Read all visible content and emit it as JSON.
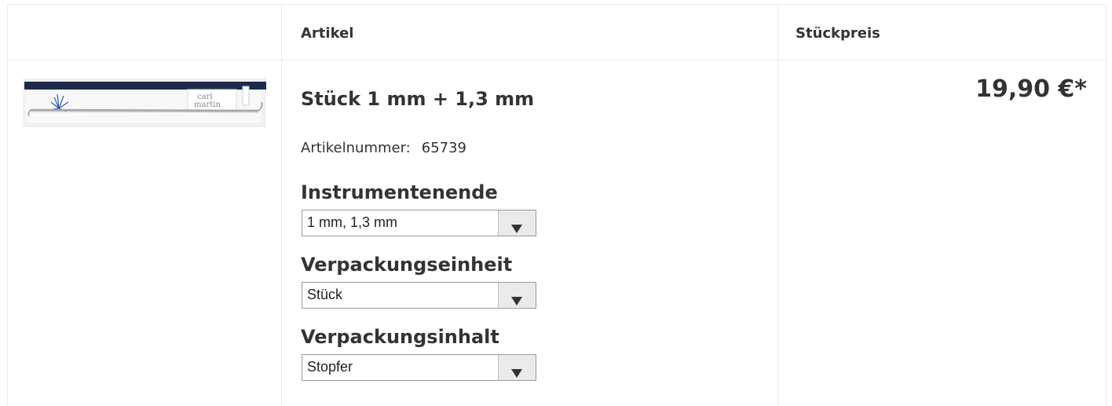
{
  "table": {
    "headers": {
      "image": "",
      "article": "Artikel",
      "unit_price": "Stückpreis"
    }
  },
  "product": {
    "image_alt": "Stopfer product image",
    "image_brand_text": "carl martin",
    "title": "Stück 1 mm + 1,3 mm",
    "article_number_label": "Artikelnummer:",
    "article_number": "65739",
    "price": "19,90 €*",
    "options": [
      {
        "label": "Instrumentenende",
        "selected": "1 mm, 1,3 mm"
      },
      {
        "label": "Verpackungseinheit",
        "selected": "Stück"
      },
      {
        "label": "Verpackungsinhalt",
        "selected": "Stopfer"
      }
    ]
  },
  "colors": {
    "text": "#333333",
    "border": "#ececec",
    "select_border": "#9a9a9a",
    "select_button": "#eaeaea"
  },
  "icons": {
    "select_arrow": "chevron-down-icon"
  }
}
